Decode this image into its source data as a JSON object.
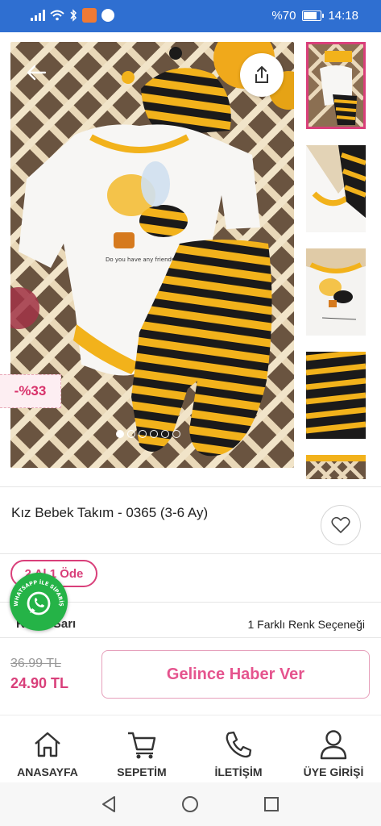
{
  "status_bar": {
    "battery_text": "%70",
    "time": "14:18"
  },
  "product": {
    "discount_badge": "-%33",
    "title": "Kız Bebek Takım - 0365 (3-6 Ay)",
    "promo_badge": "2 Al 1 Öde",
    "color_label": "Renk: Sarı",
    "variant_count_text": "1 Farklı Renk Seçeneği",
    "old_price": "36.99 TL",
    "new_price": "24.90 TL",
    "notify_button": "Gelince Haber Ver",
    "image_count": 6,
    "active_image_index": 0
  },
  "whatsapp_badge": {
    "text": "WHATSAPP İLE SİPARİŞ"
  },
  "bottom_nav": {
    "items": [
      {
        "label": "ANASAYFA",
        "icon": "home-icon"
      },
      {
        "label": "SEPETİM",
        "icon": "cart-icon"
      },
      {
        "label": "İLETİŞİM",
        "icon": "phone-icon"
      },
      {
        "label": "ÜYE GİRİŞİ",
        "icon": "user-icon"
      }
    ]
  },
  "colors": {
    "accent": "#d93f7a",
    "status_bar": "#2f6fd1",
    "whatsapp": "#25b347"
  }
}
